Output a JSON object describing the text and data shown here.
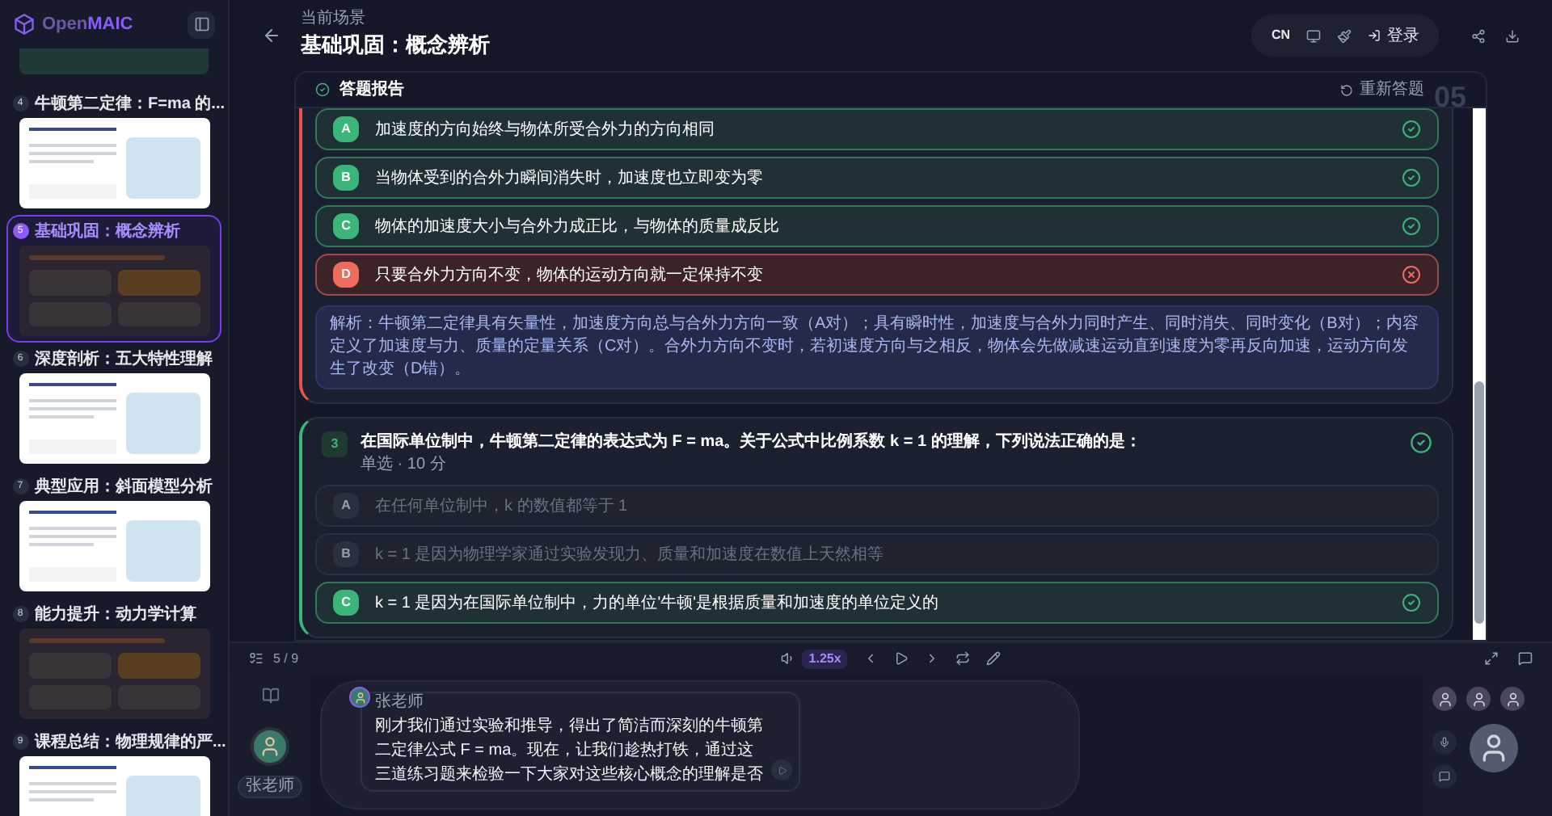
{
  "logo": {
    "text": "Open**MAIC**"
  },
  "sidebar": {
    "scenes": [
      {
        "number": "4",
        "title": "牛顿第二定律：F=ma 的...",
        "kind": "slide",
        "selected": false
      },
      {
        "number": "5",
        "title": "基础巩固：概念辨析",
        "kind": "quiz",
        "selected": true
      },
      {
        "number": "6",
        "title": "深度剖析：五大特性理解",
        "kind": "slide",
        "selected": false
      },
      {
        "number": "7",
        "title": "典型应用：斜面模型分析",
        "kind": "slide",
        "selected": false
      },
      {
        "number": "8",
        "title": "能力提升：动力学计算",
        "kind": "quiz",
        "selected": false
      },
      {
        "number": "9",
        "title": "课程总结：物理规律的严...",
        "kind": "slide",
        "selected": false
      }
    ]
  },
  "header": {
    "subtitle": "当前场景",
    "title": "基础巩固：概念辨析",
    "language": "CN",
    "login": "登录"
  },
  "report": {
    "title": "答题报告",
    "retry": "重新答题",
    "page_number": "05"
  },
  "questions": [
    {
      "correct": false,
      "options": [
        {
          "letter": "A",
          "text": "加速度的方向始终与物体所受合外力的方向相同",
          "kind": "correct"
        },
        {
          "letter": "B",
          "text": "当物体受到的合外力瞬间消失时，加速度也立即变为零",
          "kind": "correct"
        },
        {
          "letter": "C",
          "text": "物体的加速度大小与合外力成正比，与物体的质量成反比",
          "kind": "correct"
        },
        {
          "letter": "D",
          "text": "只要合外力方向不变，物体的运动方向就一定保持不变",
          "kind": "wrong"
        }
      ],
      "explanation": "解析：牛顿第二定律具有矢量性，加速度方向总与合外力方向一致（A对）；具有瞬时性，加速度与合外力同时产生、同时消失、同时变化（B对）；内容定义了加速度与力、质量的定量关系（C对）。合外力方向不变时，若初速度方向与之相反，物体会先做减速运动直到速度为零再反向加速，运动方向发生了改变（D错）。"
    },
    {
      "number": "3",
      "prompt": "在国际单位制中，牛顿第二定律的表达式为 F = ma。关于公式中比例系数 k = 1 的理解，下列说法正确的是：",
      "meta": "单选 · 10 分",
      "correct": true,
      "options": [
        {
          "letter": "A",
          "text": "在任何单位制中，k 的数值都等于 1",
          "kind": "neutral"
        },
        {
          "letter": "B",
          "text": "k = 1 是因为物理学家通过实验发现力、质量和加速度在数值上天然相等",
          "kind": "neutral"
        },
        {
          "letter": "C",
          "text": "k = 1 是因为在国际单位制中，力的单位'牛顿'是根据质量和加速度的单位定义的",
          "kind": "correct"
        }
      ]
    }
  ],
  "player": {
    "page": "5 / 9",
    "speed": "1.25x"
  },
  "teacher": {
    "name": "张老师",
    "speaker": "张老师",
    "message": "刚才我们通过实验和推导，得出了简洁而深刻的牛顿第二定律公式 F = ma。现在，让我们趁热打铁，通过这三道练习题来检验一下大家对这些核心概念的理解是否"
  }
}
